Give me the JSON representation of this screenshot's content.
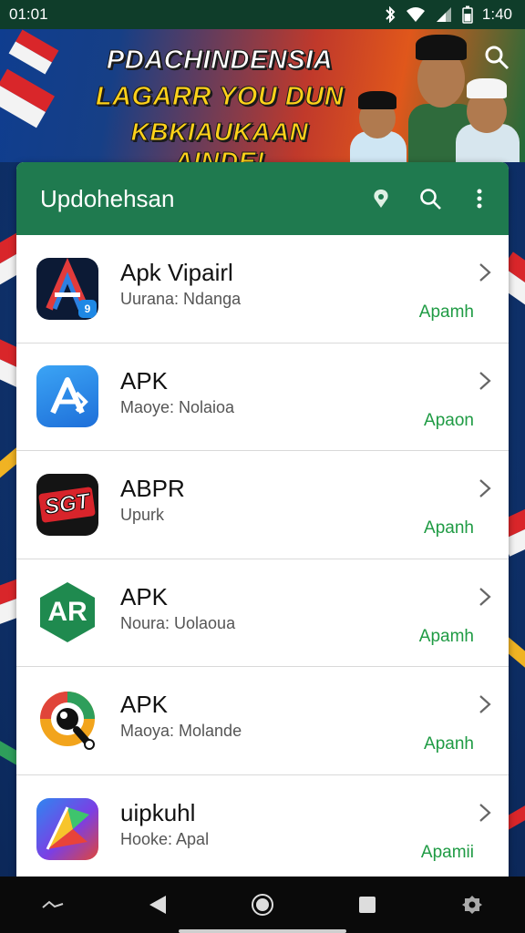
{
  "status_bar": {
    "time_left": "01:01",
    "time_right": "1:40",
    "icons": [
      "bluetooth-icon",
      "wifi-icon",
      "signal-icon",
      "battery-icon"
    ]
  },
  "banner": {
    "line1": "PDACHINDENSIA",
    "line2": "LAGARR YOU DUN",
    "line3": "KBKIAUKAAN AINDE!"
  },
  "app_bar": {
    "title": "Updohehsan",
    "icons": [
      "location-icon",
      "search-icon",
      "more-vert-icon"
    ]
  },
  "apps": [
    {
      "title": "Apk Vipairl",
      "subtitle": "Uurana: Ndanga",
      "action": "Apamh",
      "icon": "apk-a-badge-icon",
      "badge": "9"
    },
    {
      "title": "APK",
      "subtitle": "Maoye: Nolaioa",
      "action": "Apaon",
      "icon": "app-store-icon"
    },
    {
      "title": "ABPR",
      "subtitle": "Upurk",
      "action": "Apanh",
      "icon": "sgt-logo-icon",
      "logo_text": "SGT"
    },
    {
      "title": "APK",
      "subtitle": "Noura: Uolaoua",
      "action": "Apamh",
      "icon": "ar-hexagon-icon",
      "logo_text": "AR"
    },
    {
      "title": "APK",
      "subtitle": "Maoya: Molande",
      "action": "Apanh",
      "icon": "camera-lens-icon"
    },
    {
      "title": "uipkuhl",
      "subtitle": "Hooke: Apal",
      "action": "Apamii",
      "icon": "colorful-arrow-icon"
    }
  ],
  "colors": {
    "app_bar": "#1f7a4f",
    "action_green": "#1f9b44",
    "status_bar": "#0f3d2a",
    "background": "#123a78"
  },
  "nav_bar": {
    "icons": [
      "gesture-icon",
      "back-icon",
      "home-icon",
      "recents-icon",
      "settings-icon"
    ]
  }
}
